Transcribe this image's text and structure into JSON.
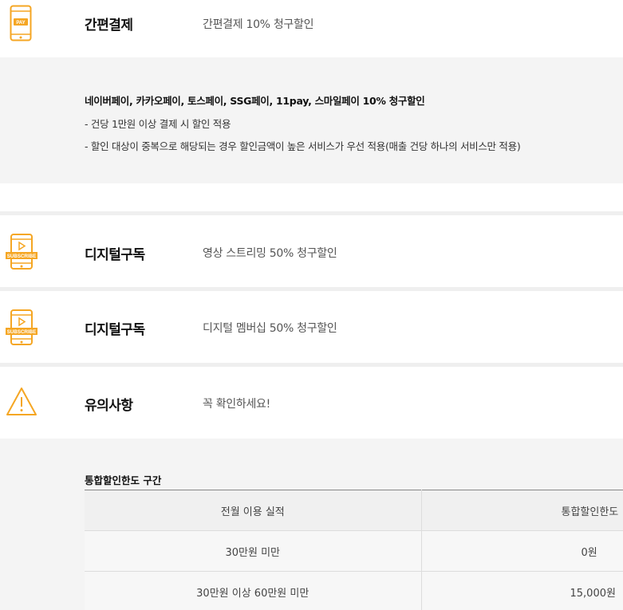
{
  "sections": [
    {
      "id": "easy-pay",
      "icon": "mobile-pay-icon",
      "title": "간편결제",
      "desc": "간편결제 10% 청구할인"
    },
    {
      "id": "digital-video",
      "icon": "subscribe-phone-icon",
      "title": "디지털구독",
      "desc": "영상 스트리밍 50% 청구할인"
    },
    {
      "id": "digital-member",
      "icon": "subscribe-phone-icon",
      "title": "디지털구독",
      "desc": "디지털 멤버십 50% 청구할인"
    },
    {
      "id": "caution",
      "icon": "warning-icon",
      "title": "유의사항",
      "desc": "꼭 확인하세요!"
    }
  ],
  "pay_icon_text": "PAY",
  "subscribe_icon_text": "SUBSCRIBE",
  "easy_pay_detail": {
    "headline": "네이버페이, 카카오페이, 토스페이, SSG페이, 11pay, 스마일페이 10% 청구할인",
    "lines": [
      "- 건당 1만원 이상 결제 시 할인 적용",
      "- 할인 대상이 중복으로 해당되는 경우 할인금액이 높은 서비스가 우선 적용(매출 건당 하나의 서비스만 적용)"
    ]
  },
  "limit_table": {
    "title": "통합할인한도 구간",
    "headers": [
      "전월 이용 실적",
      "통합할인한도"
    ],
    "rows": [
      [
        "30만원 미만",
        "0원"
      ],
      [
        "30만원 이상 60만원 미만",
        "15,000원"
      ]
    ]
  },
  "colors": {
    "accent": "#f5a623",
    "bg_gray": "#f4f4f4"
  }
}
